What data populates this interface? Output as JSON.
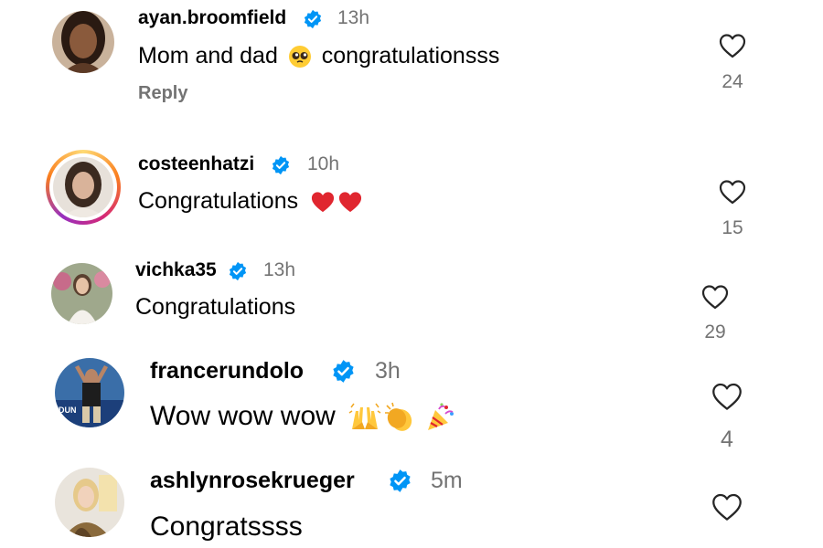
{
  "comments": [
    {
      "username": "ayan.broomfield",
      "verified": true,
      "time": "13h",
      "text": "Mom and dad",
      "text_after": "congratulationsss",
      "emojis": [
        "pleading-face-emoji"
      ],
      "reply_label": "Reply",
      "likes": "24"
    },
    {
      "username": "costeenhatzi",
      "verified": true,
      "time": "10h",
      "text": "Congratulations",
      "emojis": [
        "red-heart-emoji",
        "red-heart-emoji"
      ],
      "likes": "15",
      "story_ring": true
    },
    {
      "username": "vichka35",
      "verified": true,
      "time": "13h",
      "text": "Congratulations",
      "likes": "29"
    },
    {
      "username": "francerundolo",
      "verified": true,
      "time": "3h",
      "text": "Wow wow wow",
      "emojis": [
        "raising-hands-emoji",
        "clapping-hands-emoji",
        "party-popper-emoji"
      ],
      "likes": "4"
    },
    {
      "username": "ashlynrosekrueger",
      "verified": true,
      "time": "5m",
      "text": "Congratssss"
    }
  ],
  "colors": {
    "verified_badge": "#0095f6",
    "secondary_text": "#737373",
    "story_ring_start": "#feda75",
    "story_ring_mid": "#d62976",
    "story_ring_end": "#962fbf",
    "heart_outline": "#262626"
  },
  "icons": {
    "like": "heart-outline-icon",
    "verified": "verified-badge-icon"
  }
}
